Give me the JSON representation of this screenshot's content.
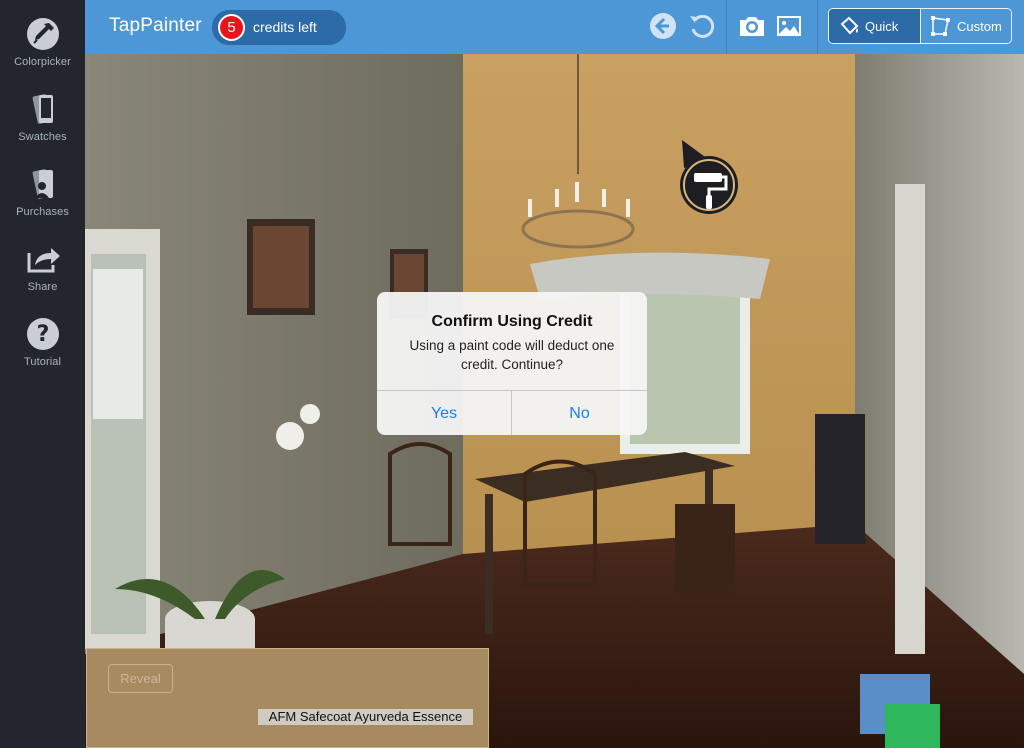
{
  "app": {
    "title": "TapPainter"
  },
  "credits": {
    "count": "5",
    "label": "credits left"
  },
  "sidebar": {
    "items": [
      {
        "label": "Colorpicker",
        "icon": "eyedropper-icon"
      },
      {
        "label": "Swatches",
        "icon": "swatches-icon"
      },
      {
        "label": "Purchases",
        "icon": "purchases-icon"
      },
      {
        "label": "Share",
        "icon": "share-icon"
      },
      {
        "label": "Tutorial",
        "icon": "question-icon"
      }
    ]
  },
  "toolbar": {
    "icons": [
      "back-arrow-icon",
      "undo-icon",
      "camera-icon",
      "photo-library-icon"
    ],
    "mode": {
      "quick": "Quick",
      "custom": "Custom",
      "selected": "Quick"
    }
  },
  "dialog": {
    "title": "Confirm Using Credit",
    "message": "Using a paint code will deduct one credit. Continue?",
    "yes": "Yes",
    "no": "No"
  },
  "swatch": {
    "reveal": "Reveal",
    "paint_name": "AFM Safecoat Ayurveda Essence",
    "color": "#a88a61"
  },
  "colors": {
    "topbar": "#4e97d6",
    "sidebar": "#23272d",
    "accent_badge": "#e8141c",
    "dialog_button": "#1a7ef7"
  }
}
